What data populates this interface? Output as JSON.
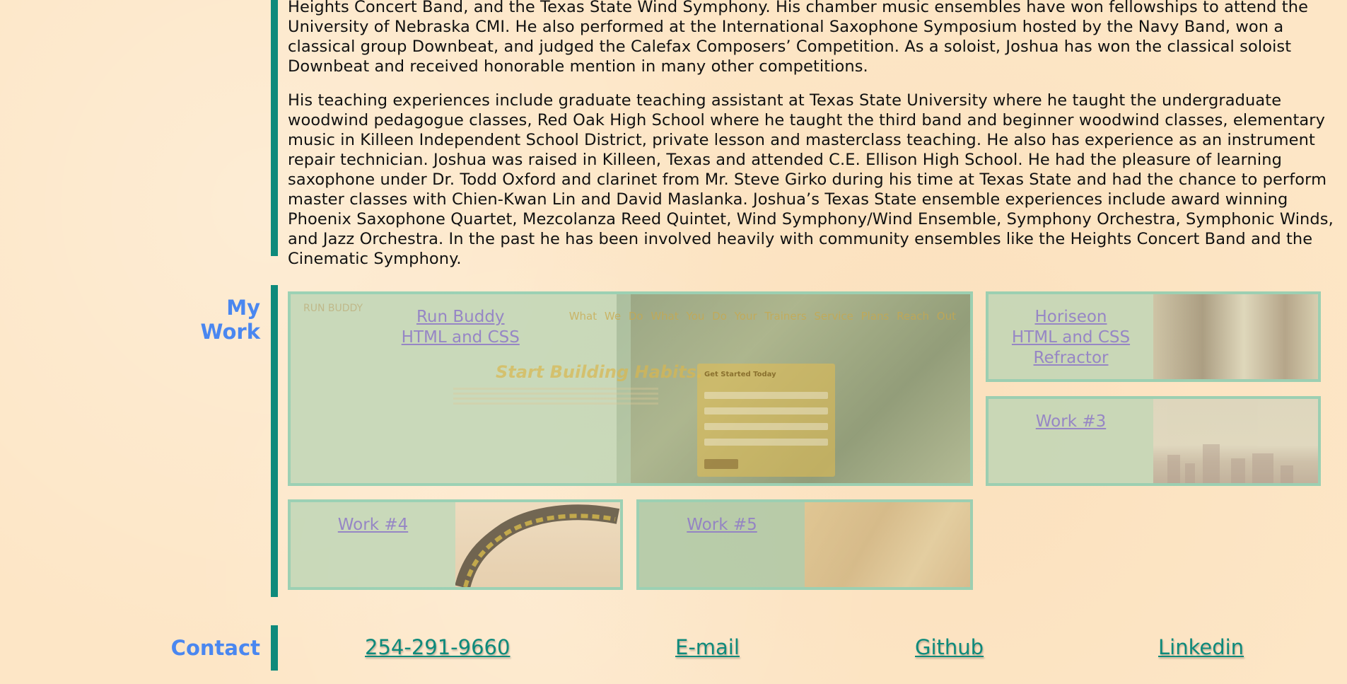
{
  "about": {
    "paragraphs": [
      "Heights Concert Band, and the Texas State Wind Symphony. His chamber music ensembles have won fellowships to attend the University of Nebraska CMI. He also performed at the International Saxophone Symposium hosted by the Navy Band, won a classical group Downbeat, and judged the Calefax Composers’ Competition. As a soloist, Joshua has won the classical soloist Downbeat and received honorable mention in many other competitions.",
      "His teaching experiences include graduate teaching assistant at Texas State University where he taught the undergraduate woodwind pedagogue classes, Red Oak High School where he taught the third band and beginner woodwind classes, elementary music in Killeen Independent School District, private lesson and masterclass teaching. He also has experience as an instrument repair technician. Joshua was raised in Killeen, Texas and attended C.E. Ellison High School. He had the pleasure of learning saxophone under Dr. Todd Oxford and clarinet from Mr. Steve Girko during his time at Texas State and had the chance to perform master classes with Chien-Kwan Lin and David Maslanka. Joshua’s Texas State ensemble experiences include award winning Phoenix Saxophone Quartet, Mezcolanza Reed Quintet, Wind Symphony/Wind Ensemble, Symphony Orchestra, Symphonic Winds, and Jazz Orchestra. In the past he has been involved heavily with community ensembles like the Heights Concert Band and the Cinematic Symphony."
    ]
  },
  "work": {
    "heading_line1": "My",
    "heading_line2": "Work",
    "tiles": [
      {
        "line1": "Run Buddy",
        "line2": "HTML and CSS",
        "screenshot": {
          "logo": "RUN BUDDY",
          "nav": "What We Do  What You Do  Your Trainers  Service Plans  Reach Out",
          "hero": "Start Building Habits.",
          "form_title": "Get Started Today"
        }
      },
      {
        "line1": "Horiseon",
        "line2": "HTML and CSS",
        "line3": "Refractor"
      },
      {
        "line1": "Work #3"
      },
      {
        "line1": "Work #4"
      },
      {
        "line1": "Work #5"
      }
    ]
  },
  "contact": {
    "heading": "Contact",
    "phone": "254-291-9660",
    "email": "E-mail",
    "github": "Github",
    "linkedin": "Linkedin"
  },
  "colors": {
    "accent_teal": "#0e8a7b",
    "heading_blue": "#4a87f0",
    "page_background": "#fde6c6",
    "tile_link_purple": "#8e78c8"
  }
}
